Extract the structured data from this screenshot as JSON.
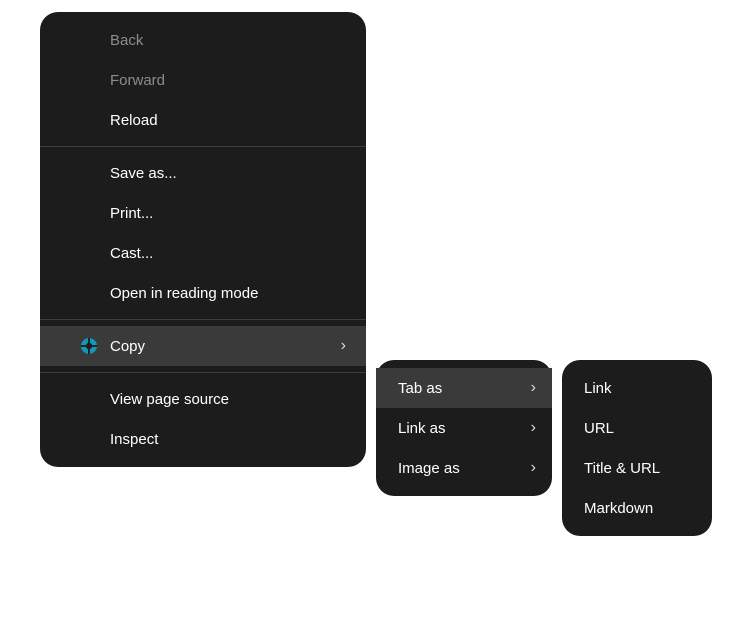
{
  "main_menu": {
    "group1": {
      "back": {
        "label": "Back",
        "enabled": false
      },
      "forward": {
        "label": "Forward",
        "enabled": false
      },
      "reload": {
        "label": "Reload",
        "enabled": true
      }
    },
    "group2": {
      "save_as": {
        "label": "Save as..."
      },
      "print": {
        "label": "Print..."
      },
      "cast": {
        "label": "Cast..."
      },
      "reading_mode": {
        "label": "Open in reading mode"
      }
    },
    "group3": {
      "copy": {
        "label": "Copy",
        "has_submenu": true,
        "highlighted": true,
        "icon": "extension-icon"
      }
    },
    "group4": {
      "view_source": {
        "label": "View page source"
      },
      "inspect": {
        "label": "Inspect"
      }
    }
  },
  "submenu_copy": {
    "tab_as": {
      "label": "Tab as",
      "has_submenu": true,
      "highlighted": true
    },
    "link_as": {
      "label": "Link as",
      "has_submenu": true
    },
    "image_as": {
      "label": "Image as",
      "has_submenu": true
    }
  },
  "submenu_tab_as": {
    "link": {
      "label": "Link"
    },
    "url": {
      "label": "URL"
    },
    "title_url": {
      "label": "Title & URL"
    },
    "markdown": {
      "label": "Markdown"
    }
  },
  "glyphs": {
    "chevron_right": "›"
  }
}
